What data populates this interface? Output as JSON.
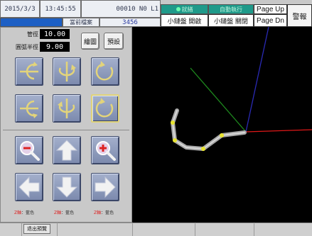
{
  "header": {
    "date": "2015/3/3",
    "time": "13:45:55",
    "program_code": "00010 N0 L1",
    "current_file_label": "當前檔案",
    "current_file_value": "3456",
    "status_ready": "就緒",
    "status_auto": "自動執行",
    "small_clamp_open": "小鏈盤 開啟",
    "small_clamp_close": "小鏈盤 關閉",
    "page_up": "Page Up",
    "page_down": "Page Dn",
    "alarm": "警報"
  },
  "panel": {
    "pipe_diameter_label": "管徑",
    "pipe_diameter_value": "10.00",
    "bend_radius_label": "圓弧半徑",
    "bend_radius_value": "9.00",
    "draw_button": "繪圖",
    "preview_button": "預設",
    "axis_labels": [
      {
        "axis": "Z軸",
        "color": "藍色"
      },
      {
        "axis": "Z軸",
        "color": "藍色"
      },
      {
        "axis": "Z軸",
        "color": "藍色"
      }
    ]
  },
  "footer": {
    "exit_preview": "退出預覽"
  },
  "colors": {
    "view_bg": "#000000",
    "axis_x": "#e01818",
    "axis_y": "#1e8a1e",
    "axis_z": "#2a2ab4",
    "pipe": "#b4b4b4",
    "joint": "#e8e430",
    "tile_arrow": "#f2f2f2",
    "tile_rotate": "#e3d47a"
  },
  "icons": {
    "rotate_x": "rotate-x-icon",
    "rotate_y": "rotate-y-icon",
    "rotate_z": "rotate-z-icon",
    "zoom_out": "zoom-out-icon",
    "zoom_in": "zoom-in-icon",
    "arrows": [
      "arrow-up-icon",
      "arrow-left-icon",
      "arrow-down-icon",
      "arrow-right-icon"
    ]
  }
}
